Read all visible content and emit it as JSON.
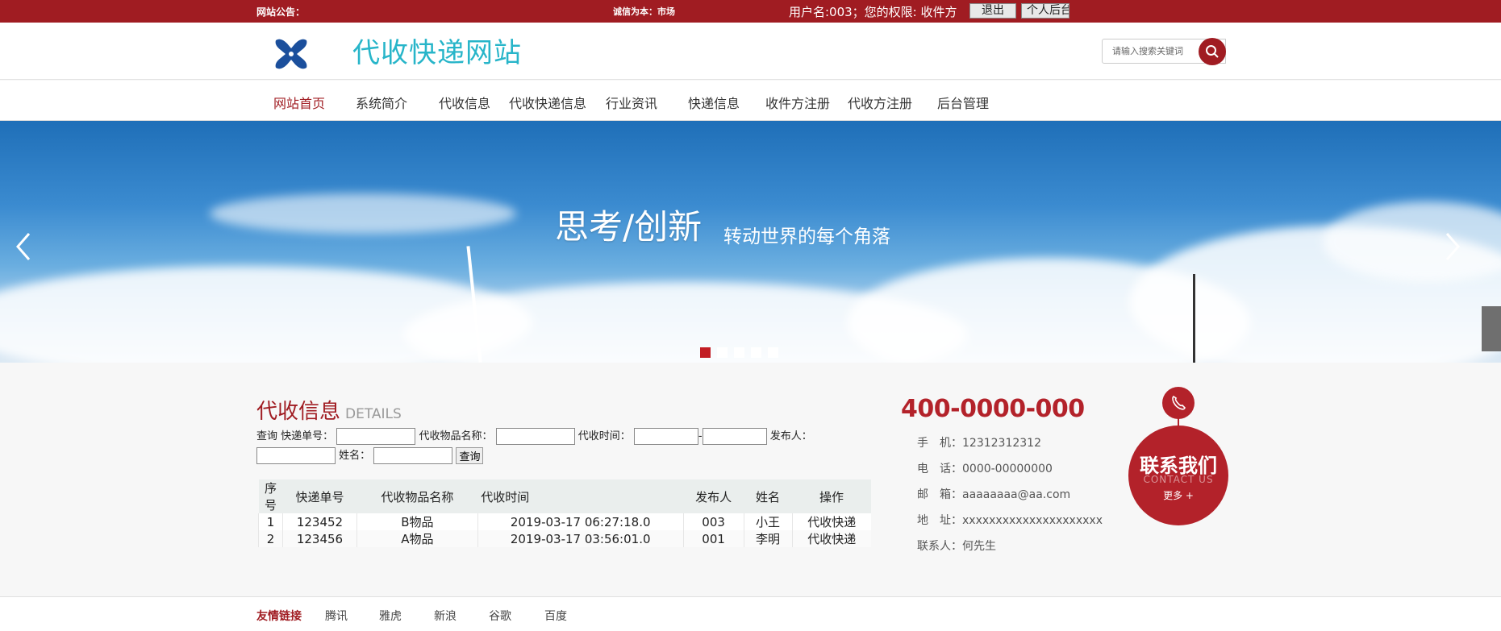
{
  "topbar": {
    "notice_label": "网站公告：",
    "marquee": "诚信为本：市场",
    "user_text": "用户名:003；您的权限: 收件方",
    "logout_label": "退出",
    "profile_label": "个人后台"
  },
  "header": {
    "site_title": "代收快递网站",
    "search_placeholder": "请输入搜索关键词"
  },
  "nav": {
    "items": [
      "网站首页",
      "系统简介",
      "代收信息",
      "代收快递信息",
      "行业资讯",
      "快递信息",
      "收件方注册",
      "代收方注册",
      "后台管理"
    ],
    "active_index": 0
  },
  "banner": {
    "slogan": "思考/创新",
    "sub": "转动世界的每个角落",
    "slide_count": 5,
    "active_slide": 0
  },
  "details": {
    "title": "代收信息",
    "title_en": "DETAILS",
    "query": {
      "prefix": "查询",
      "tracking_label": "快递单号：",
      "item_label": "代收物品名称：",
      "time_label": "代收时间：",
      "dash": "-",
      "publisher_label": "发布人：",
      "name_label": "姓名：",
      "button": "查询"
    },
    "table": {
      "headers": [
        "序号",
        "快递单号",
        "代收物品名称",
        "代收时间",
        "发布人",
        "姓名",
        "操作"
      ],
      "rows": [
        [
          "1",
          "123452",
          "B物品",
          "2019-03-17 06:27:18.0",
          "003",
          "小王",
          "代收快递"
        ],
        [
          "2",
          "123456",
          "A物品",
          "2019-03-17 03:56:01.0",
          "001",
          "李明",
          "代收快递"
        ]
      ]
    }
  },
  "contact": {
    "phone_big": "400-0000-000",
    "mobile": "手　机：12312312312",
    "tel": "电　话：0000-00000000",
    "email": "邮　箱：aaaaaaaa@aa.com",
    "address": "地　址：xxxxxxxxxxxxxxxxxxxxx",
    "person": "联系人：何先生",
    "badge_title": "联系我们",
    "badge_en": "CONTACT US",
    "badge_more": "更多 +"
  },
  "links": {
    "label": "友情链接",
    "items": [
      "腾讯",
      "雅虎",
      "新浪",
      "谷歌",
      "百度"
    ]
  },
  "colors": {
    "brand_red": "#a01c22",
    "title_cyan": "#27b5c9"
  }
}
